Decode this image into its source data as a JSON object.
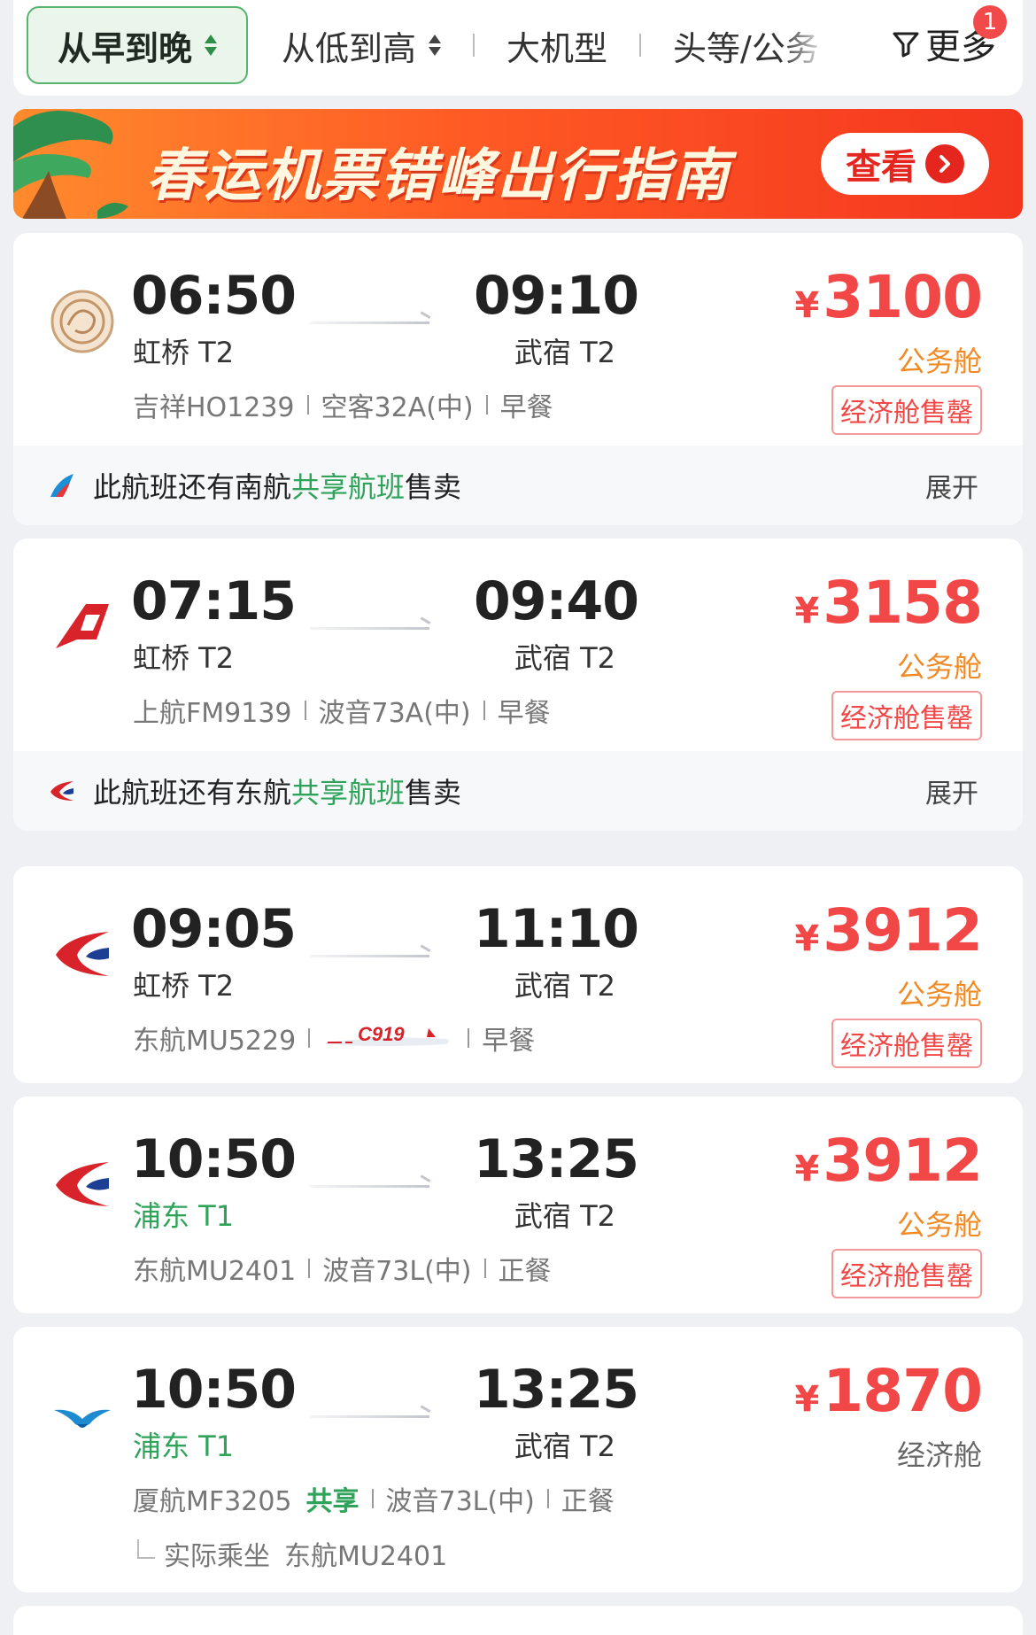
{
  "sortbar": {
    "active": "从早到晚",
    "price_sort": "从低到高",
    "big_plane": "大机型",
    "cabin_filter": "头等/公务",
    "more": "更多",
    "more_badge": "1"
  },
  "banner": {
    "title": "春运机票错峰出行指南",
    "button": "查看"
  },
  "flights": [
    {
      "logo": "juneyao-air-logo",
      "dep_time": "06:50",
      "dep_airport": "虹桥 T2",
      "arr_time": "09:10",
      "arr_airport": "武宿 T2",
      "airline_flight": "吉祥HO1239",
      "aircraft": "空客32A(中)",
      "meal": "早餐",
      "price_symbol": "¥",
      "price": "3100",
      "cabin": "公务舱",
      "status": "经济舱售罄",
      "codeshare": {
        "prefix": "此航班还有南航",
        "highlight": "共享航班",
        "suffix": "售卖",
        "expand": "展开"
      }
    },
    {
      "logo": "shanghai-airlines-logo",
      "dep_time": "07:15",
      "dep_airport": "虹桥 T2",
      "arr_time": "09:40",
      "arr_airport": "武宿 T2",
      "airline_flight": "上航FM9139",
      "aircraft": "波音73A(中)",
      "meal": "早餐",
      "price_symbol": "¥",
      "price": "3158",
      "cabin": "公务舱",
      "status": "经济舱售罄",
      "codeshare": {
        "prefix": "此航班还有东航",
        "highlight": "共享航班",
        "suffix": "售卖",
        "expand": "展开"
      }
    },
    {
      "logo": "china-eastern-logo",
      "dep_time": "09:05",
      "dep_airport": "虹桥 T2",
      "arr_time": "11:10",
      "arr_airport": "武宿 T2",
      "airline_flight": "东航MU5229",
      "aircraft": "C919",
      "meal": "早餐",
      "price_symbol": "¥",
      "price": "3912",
      "cabin": "公务舱",
      "status": "经济舱售罄"
    },
    {
      "logo": "china-eastern-logo",
      "dep_time": "10:50",
      "dep_airport": "浦东 T1",
      "arr_time": "13:25",
      "arr_airport": "武宿 T2",
      "airline_flight": "东航MU2401",
      "aircraft": "波音73L(中)",
      "meal": "正餐",
      "price_symbol": "¥",
      "price": "3912",
      "cabin": "公务舱",
      "status": "经济舱售罄"
    },
    {
      "logo": "xiamen-airlines-logo",
      "dep_time": "10:50",
      "dep_airport": "浦东 T1",
      "arr_time": "13:25",
      "arr_airport": "武宿 T2",
      "airline_flight": "厦航MF3205",
      "share_tag": "共享",
      "aircraft": "波音73L(中)",
      "meal": "正餐",
      "actual_label": "实际乘坐",
      "actual_flight": "东航MU2401",
      "price_symbol": "¥",
      "price": "1870",
      "cabin": "经济舱"
    }
  ],
  "colors": {
    "price": "#f14747",
    "cabin_business": "#f08a24",
    "green": "#2fa35a",
    "banner_start": "#ff8a2d",
    "banner_end": "#f4361f"
  }
}
